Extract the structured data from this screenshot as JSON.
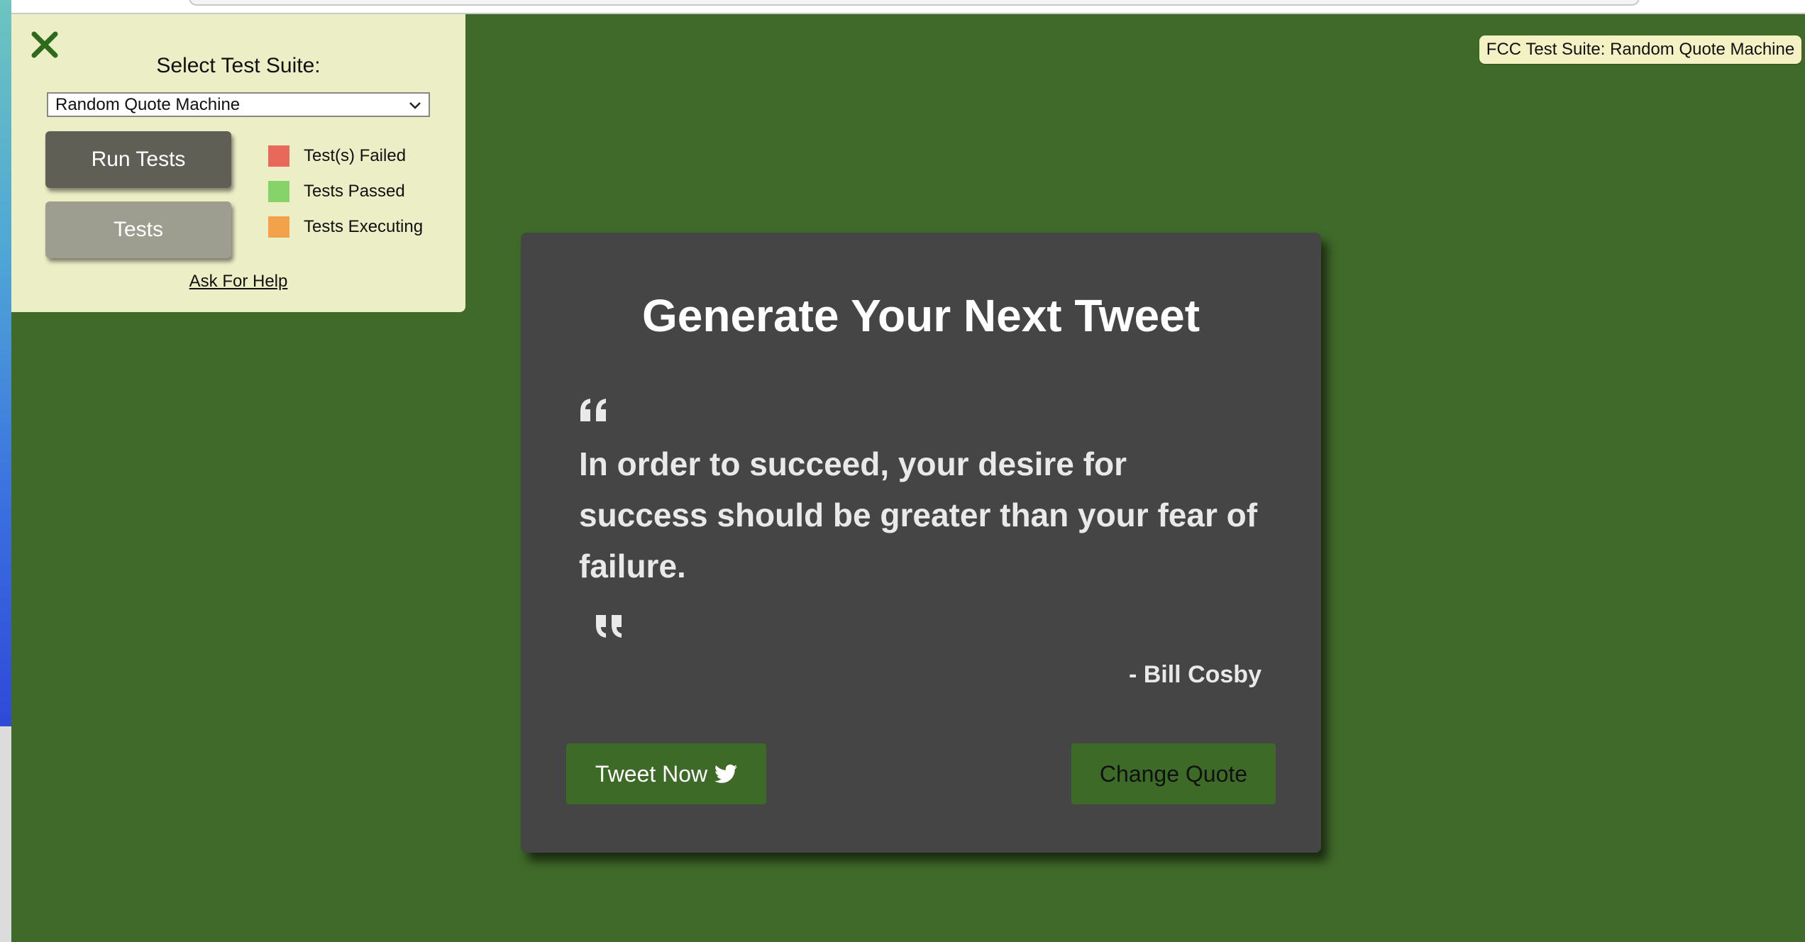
{
  "fcc_panel": {
    "suite_label": "Select Test Suite:",
    "selected_suite": "Random Quote Machine",
    "run_tests_label": "Run Tests",
    "tests_label": "Tests",
    "legend": [
      {
        "label": "Test(s) Failed",
        "color": "#e8695a"
      },
      {
        "label": "Tests Passed",
        "color": "#86d36a"
      },
      {
        "label": "Tests Executing",
        "color": "#f2a248"
      }
    ],
    "help_link": "Ask For Help"
  },
  "title_badge": "FCC Test Suite: Random Quote Machine",
  "quote_card": {
    "title": "Generate Your Next Tweet",
    "quote": "In order to succeed, your desire for success should be greater than your fear of failure.",
    "author": "- Bill Cosby",
    "tweet_button": "Tweet Now",
    "change_button": "Change Quote"
  },
  "colors": {
    "background": "#406a29",
    "card": "#454545",
    "button": "#3d6a27",
    "panel": "#eceec6"
  }
}
